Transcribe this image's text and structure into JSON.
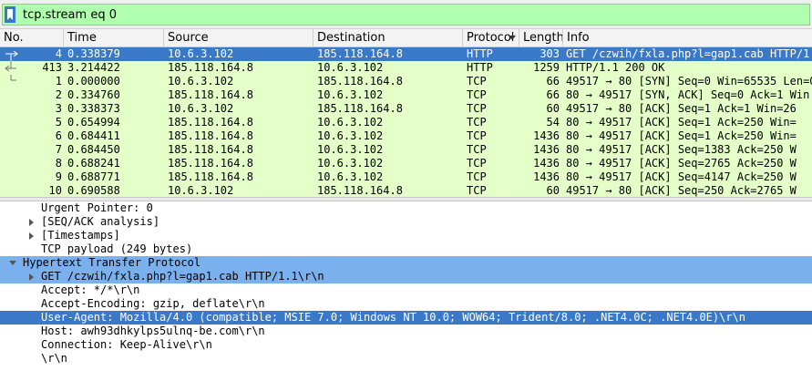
{
  "filter": {
    "text": "tcp.stream eq 0"
  },
  "packet_list": {
    "columns": [
      "No.",
      "Time",
      "Source",
      "Destination",
      "Protocol",
      "Length",
      "Info"
    ],
    "rows": [
      {
        "no": "4",
        "time": "0.338379",
        "src": "10.6.3.102",
        "dst": "185.118.164.8",
        "proto": "HTTP",
        "len": "303",
        "info": "GET /czwih/fxla.php?l=gap1.cab HTTP/1.1",
        "selected": true
      },
      {
        "no": "413",
        "time": "3.214422",
        "src": "185.118.164.8",
        "dst": "10.6.3.102",
        "proto": "HTTP",
        "len": "1259",
        "info": "HTTP/1.1 200 OK"
      },
      {
        "no": "1",
        "time": "0.000000",
        "src": "10.6.3.102",
        "dst": "185.118.164.8",
        "proto": "TCP",
        "len": "66",
        "info": "49517 → 80 [SYN] Seq=0 Win=65535 Len=0"
      },
      {
        "no": "2",
        "time": "0.334760",
        "src": "185.118.164.8",
        "dst": "10.6.3.102",
        "proto": "TCP",
        "len": "66",
        "info": "80 → 49517 [SYN, ACK] Seq=0 Ack=1 Win"
      },
      {
        "no": "3",
        "time": "0.338373",
        "src": "10.6.3.102",
        "dst": "185.118.164.8",
        "proto": "TCP",
        "len": "60",
        "info": "49517 → 80 [ACK] Seq=1 Ack=1 Win=26"
      },
      {
        "no": "5",
        "time": "0.654994",
        "src": "185.118.164.8",
        "dst": "10.6.3.102",
        "proto": "TCP",
        "len": "54",
        "info": "80 → 49517 [ACK] Seq=1 Ack=250 Win="
      },
      {
        "no": "6",
        "time": "0.684411",
        "src": "185.118.164.8",
        "dst": "10.6.3.102",
        "proto": "TCP",
        "len": "1436",
        "info": "80 → 49517 [ACK] Seq=1 Ack=250 Win="
      },
      {
        "no": "7",
        "time": "0.684450",
        "src": "185.118.164.8",
        "dst": "10.6.3.102",
        "proto": "TCP",
        "len": "1436",
        "info": "80 → 49517 [ACK] Seq=1383 Ack=250 W"
      },
      {
        "no": "8",
        "time": "0.688241",
        "src": "185.118.164.8",
        "dst": "10.6.3.102",
        "proto": "TCP",
        "len": "1436",
        "info": "80 → 49517 [ACK] Seq=2765 Ack=250 W"
      },
      {
        "no": "9",
        "time": "0.688771",
        "src": "185.118.164.8",
        "dst": "10.6.3.102",
        "proto": "TCP",
        "len": "1436",
        "info": "80 → 49517 [ACK] Seq=4147 Ack=250 W"
      },
      {
        "no": "10",
        "time": "0.690588",
        "src": "10.6.3.102",
        "dst": "185.118.164.8",
        "proto": "TCP",
        "len": "60",
        "info": "49517 → 80 [ACK] Seq=250 Ack=2765 W"
      }
    ]
  },
  "details": [
    {
      "text": "Urgent Pointer: 0",
      "indent": 2,
      "arrow": "none"
    },
    {
      "text": "[SEQ/ACK analysis]",
      "indent": 2,
      "arrow": "right"
    },
    {
      "text": "[Timestamps]",
      "indent": 2,
      "arrow": "right"
    },
    {
      "text": "TCP payload (249 bytes)",
      "indent": 2,
      "arrow": "none"
    },
    {
      "text": "Hypertext Transfer Protocol",
      "indent": 1,
      "arrow": "down",
      "style": "hl"
    },
    {
      "text": "GET /czwih/fxla.php?l=gap1.cab HTTP/1.1\\r\\n",
      "indent": 2,
      "arrow": "right",
      "style": "hl"
    },
    {
      "text": "Accept: */*\\r\\n",
      "indent": 2,
      "arrow": "none"
    },
    {
      "text": "Accept-Encoding: gzip, deflate\\r\\n",
      "indent": 2,
      "arrow": "none"
    },
    {
      "text": "User-Agent: Mozilla/4.0 (compatible; MSIE 7.0; Windows NT 10.0; WOW64; Trident/8.0; .NET4.0C; .NET4.0E)\\r\\n",
      "indent": 2,
      "arrow": "none",
      "style": "sel"
    },
    {
      "text": "Host: awh93dhkylps5ulnq-be.com\\r\\n",
      "indent": 2,
      "arrow": "none"
    },
    {
      "text": "Connection: Keep-Alive\\r\\n",
      "indent": 2,
      "arrow": "none"
    },
    {
      "text": "\\r\\n",
      "indent": 2,
      "arrow": "none"
    }
  ],
  "colors": {
    "tcp_row": "#e4ffc7",
    "selected": "#3a78c8",
    "highlight": "#7ab0ee",
    "filter_ok": "#afffaf"
  }
}
